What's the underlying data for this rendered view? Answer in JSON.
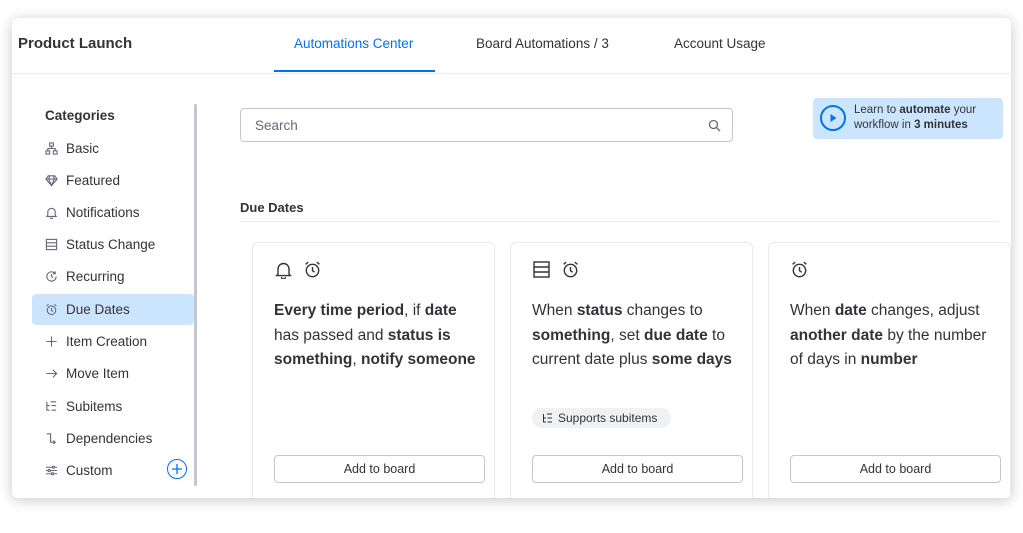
{
  "header": {
    "board_title": "Product Launch",
    "tabs": [
      {
        "label": "Automations Center",
        "active": true
      },
      {
        "label": "Board Automations / 3",
        "active": false
      },
      {
        "label": "Account Usage",
        "active": false
      }
    ]
  },
  "sidebar": {
    "title": "Categories",
    "items": [
      {
        "label": "Basic",
        "icon": "hierarchy-icon"
      },
      {
        "label": "Featured",
        "icon": "diamond-icon"
      },
      {
        "label": "Notifications",
        "icon": "bell-icon"
      },
      {
        "label": "Status Change",
        "icon": "status-list-icon"
      },
      {
        "label": "Recurring",
        "icon": "recurring-icon"
      },
      {
        "label": "Due Dates",
        "icon": "alarm-icon",
        "active": true
      },
      {
        "label": "Item Creation",
        "icon": "plus-icon"
      },
      {
        "label": "Move Item",
        "icon": "arrow-right-icon"
      },
      {
        "label": "Subitems",
        "icon": "subitems-icon"
      },
      {
        "label": "Dependencies",
        "icon": "dependency-icon"
      },
      {
        "label": "Custom",
        "icon": "sliders-icon"
      }
    ]
  },
  "search": {
    "placeholder": "Search"
  },
  "learn": {
    "pre": "Learn to ",
    "bold1": "automate",
    "mid": " your workflow in ",
    "bold2": "3 minutes"
  },
  "section": {
    "title": "Due Dates"
  },
  "cards": [
    {
      "icons": [
        "bell-icon",
        "alarm-icon"
      ],
      "segments": [
        {
          "t": "Every time period",
          "b": true
        },
        {
          "t": ", if ",
          "b": false
        },
        {
          "t": "date",
          "b": true
        },
        {
          "t": " has passed and ",
          "b": false
        },
        {
          "t": "status is something",
          "b": true
        },
        {
          "t": ", ",
          "b": false
        },
        {
          "t": "notify someone",
          "b": true
        }
      ],
      "badge": "",
      "button": "Add to board"
    },
    {
      "icons": [
        "status-list-icon",
        "alarm-icon"
      ],
      "segments": [
        {
          "t": "When ",
          "b": false
        },
        {
          "t": "status",
          "b": true
        },
        {
          "t": " changes to ",
          "b": false
        },
        {
          "t": "something",
          "b": true
        },
        {
          "t": ", set ",
          "b": false
        },
        {
          "t": "due date",
          "b": true
        },
        {
          "t": " to current date plus ",
          "b": false
        },
        {
          "t": "some days",
          "b": true
        }
      ],
      "badge": "Supports subitems",
      "button": "Add to board"
    },
    {
      "icons": [
        "alarm-icon"
      ],
      "segments": [
        {
          "t": "When ",
          "b": false
        },
        {
          "t": "date",
          "b": true
        },
        {
          "t": " changes, adjust ",
          "b": false
        },
        {
          "t": "another date",
          "b": true
        },
        {
          "t": " by the number of days in ",
          "b": false
        },
        {
          "t": "number",
          "b": true
        }
      ],
      "badge": "",
      "button": "Add to board"
    }
  ],
  "colors": {
    "accent": "#0073ea",
    "selected": "#cce5ff",
    "text": "#323338",
    "border": "#c5c7d0"
  }
}
